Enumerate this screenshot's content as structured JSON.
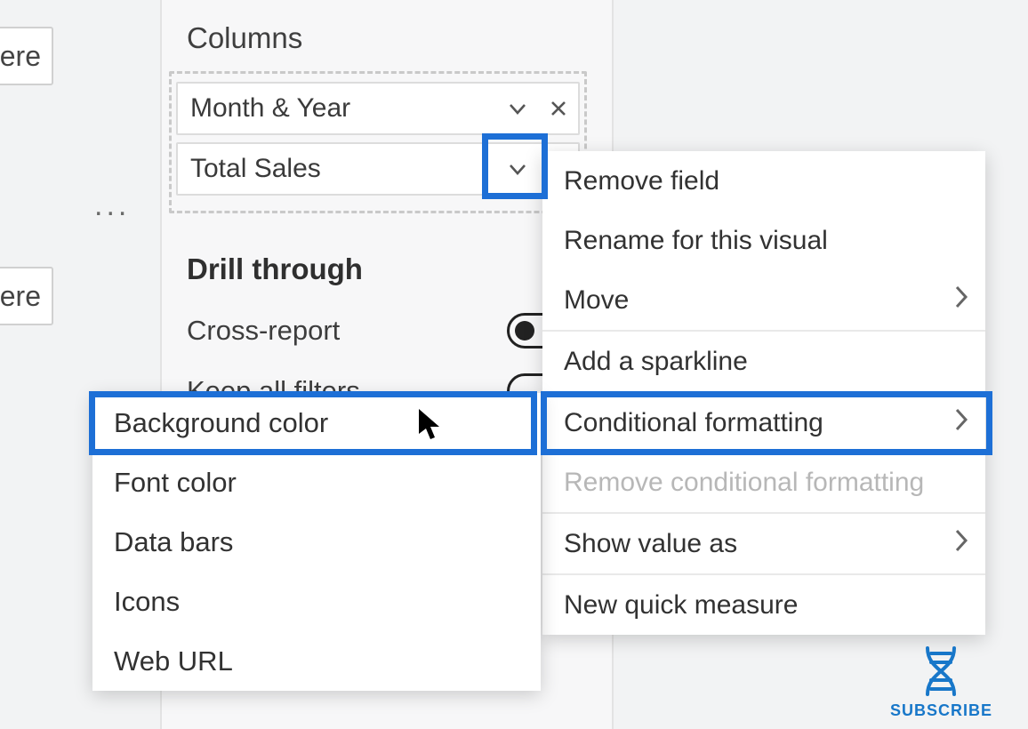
{
  "left_cards": {
    "top_text": "ere",
    "bot_text": "ere"
  },
  "ellipsis": "...",
  "sections": {
    "columns": "Columns",
    "drill": "Drill through"
  },
  "fields": {
    "month_year": "Month & Year",
    "total_sales": "Total Sales"
  },
  "settings": {
    "cross_report": "Cross-report",
    "keep_filters": "Keep all filters"
  },
  "context_menu": {
    "remove_field": "Remove field",
    "rename": "Rename for this visual",
    "move": "Move",
    "sparkline": "Add a sparkline",
    "conditional": "Conditional formatting",
    "remove_conditional": "Remove conditional formatting",
    "show_value_as": "Show value as",
    "new_quick_measure": "New quick measure"
  },
  "cf_submenu": {
    "background_color": "Background color",
    "font_color": "Font color",
    "data_bars": "Data bars",
    "icons": "Icons",
    "web_url": "Web URL"
  },
  "badge": "SUBSCRIBE"
}
